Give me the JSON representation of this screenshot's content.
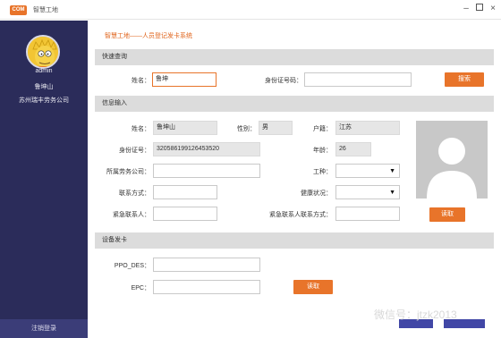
{
  "titlebar": {
    "logo_text": "COM",
    "title": "智慧工地"
  },
  "sidebar": {
    "username": "admin",
    "realname": "鲁坤山",
    "company": "苏州瑞丰劳务公司",
    "logout": "注销登录"
  },
  "page_title": "智慧工地——人员登记发卡系统",
  "quick_query": {
    "section": "快速查询",
    "name_label": "姓名：",
    "name_value": "鲁坤",
    "id_label": "身份证号码：",
    "id_value": "",
    "search_button": "搜索"
  },
  "info": {
    "section": "信息输入",
    "name_label": "姓名：",
    "name_value": "鲁坤山",
    "gender_label": "性别：",
    "gender_value": "男",
    "hukou_label": "户籍：",
    "hukou_value": "江苏",
    "id_label": "身份证号：",
    "id_value": "320586199126453520",
    "age_label": "年龄：",
    "age_value": "26",
    "company_label": "所属劳务公司：",
    "company_value": "",
    "worktype_label": "工种：",
    "worktype_value": "",
    "contact_label": "联系方式：",
    "contact_value": "",
    "health_label": "健康状况：",
    "health_value": "",
    "emergency_label": "紧急联系人：",
    "emergency_value": "",
    "emergency_contact_label": "紧急联系人联系方式：",
    "emergency_contact_value": "",
    "read_button": "读取"
  },
  "card": {
    "section": "设备发卡",
    "ppo_label": "PPO_DES：",
    "ppo_value": "",
    "epc_label": "EPC：",
    "epc_value": "",
    "read_button": "读取"
  },
  "watermark": "微信号：jtzk2013",
  "colors": {
    "accent": "#e8742a",
    "sidebar": "#2b2c5a",
    "section": "#dcdcdc"
  }
}
